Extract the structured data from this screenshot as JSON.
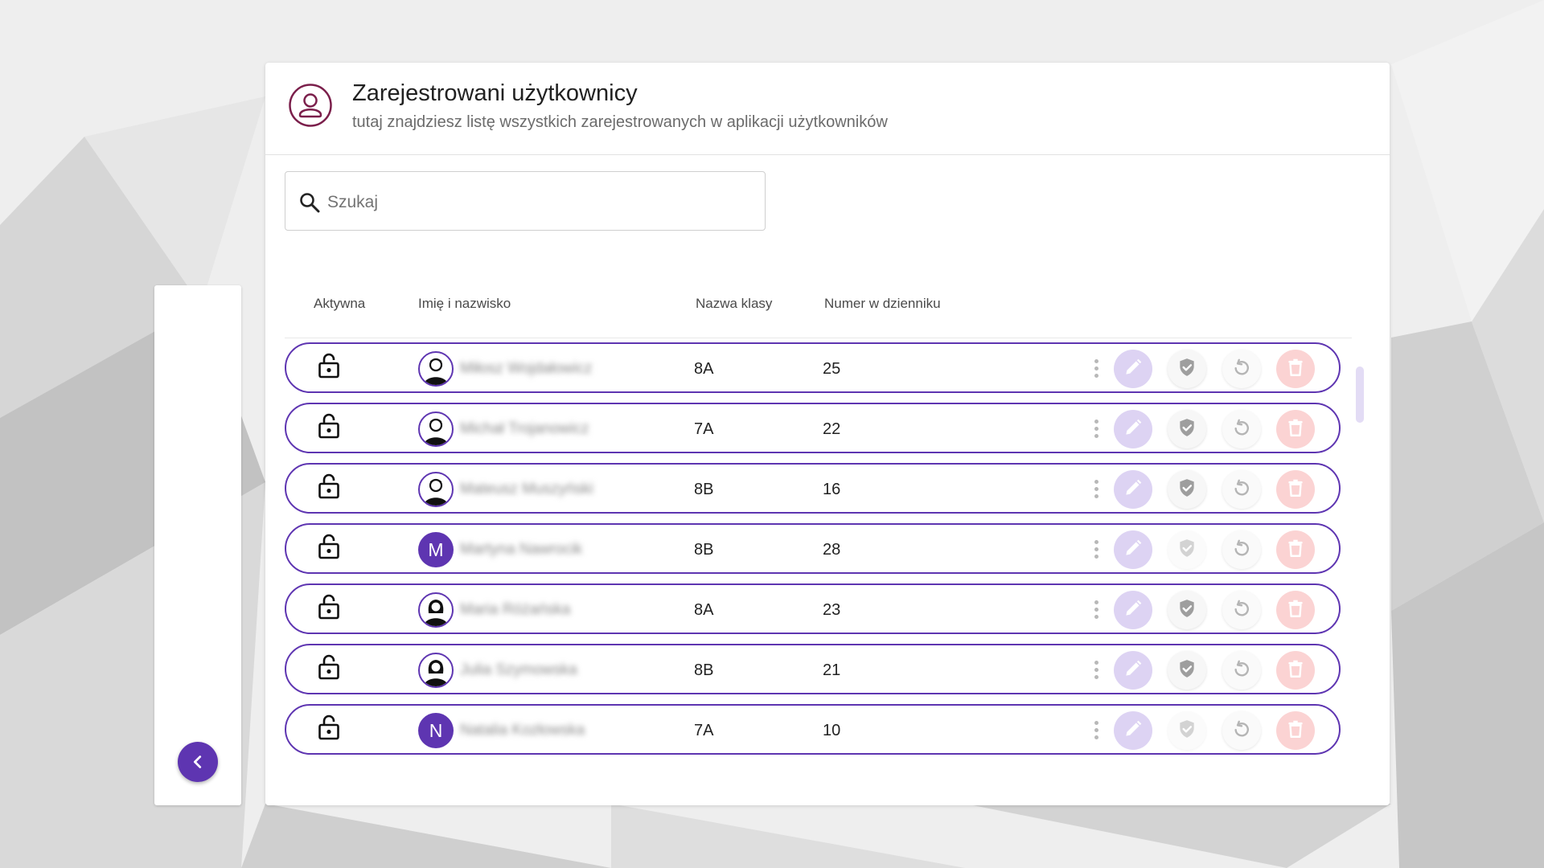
{
  "header": {
    "title": "Zarejestrowani użytkownicy",
    "subtitle": "tutaj znajdziesz listę wszystkich zarejestrowanych w aplikacji użytkowników",
    "icon": "user-profile-icon"
  },
  "search": {
    "placeholder": "Szukaj",
    "value": "",
    "icon": "search-icon"
  },
  "table": {
    "columns": [
      "Aktywna",
      "Imię i nazwisko",
      "Nazwa klasy",
      "Numer w dzienniku"
    ],
    "rows": [
      {
        "avatar": "photo-male",
        "name": "Miłosz Wojdałowicz",
        "class": "8A",
        "number": "25",
        "verified": true
      },
      {
        "avatar": "photo-male",
        "name": "Michał Trojanowicz",
        "class": "7A",
        "number": "22",
        "verified": true
      },
      {
        "avatar": "photo-male",
        "name": "Mateusz Muszyński",
        "class": "8B",
        "number": "16",
        "verified": true
      },
      {
        "avatar": "M",
        "name": "Martyna Nawrocik",
        "class": "8B",
        "number": "28",
        "verified": false
      },
      {
        "avatar": "photo-female",
        "name": "Maria Różańska",
        "class": "8A",
        "number": "23",
        "verified": true
      },
      {
        "avatar": "photo-female",
        "name": "Julia Szymowska",
        "class": "8B",
        "number": "21",
        "verified": true
      },
      {
        "avatar": "N",
        "name": "Natalia Kozłowska",
        "class": "7A",
        "number": "10",
        "verified": false
      }
    ]
  },
  "icons": {
    "lock": "lock-open-icon",
    "menu": "more-vert-icon",
    "edit": "pencil-icon",
    "verify": "shield-check-icon",
    "reset": "reset-icon",
    "delete": "trash-icon",
    "collapse": "chevron-left-icon"
  },
  "colors": {
    "accent": "#5e35b1",
    "header_icon": "#7b1f4b",
    "edit_bg": "#ddd3f3",
    "delete_bg": "#fbd3d3"
  }
}
